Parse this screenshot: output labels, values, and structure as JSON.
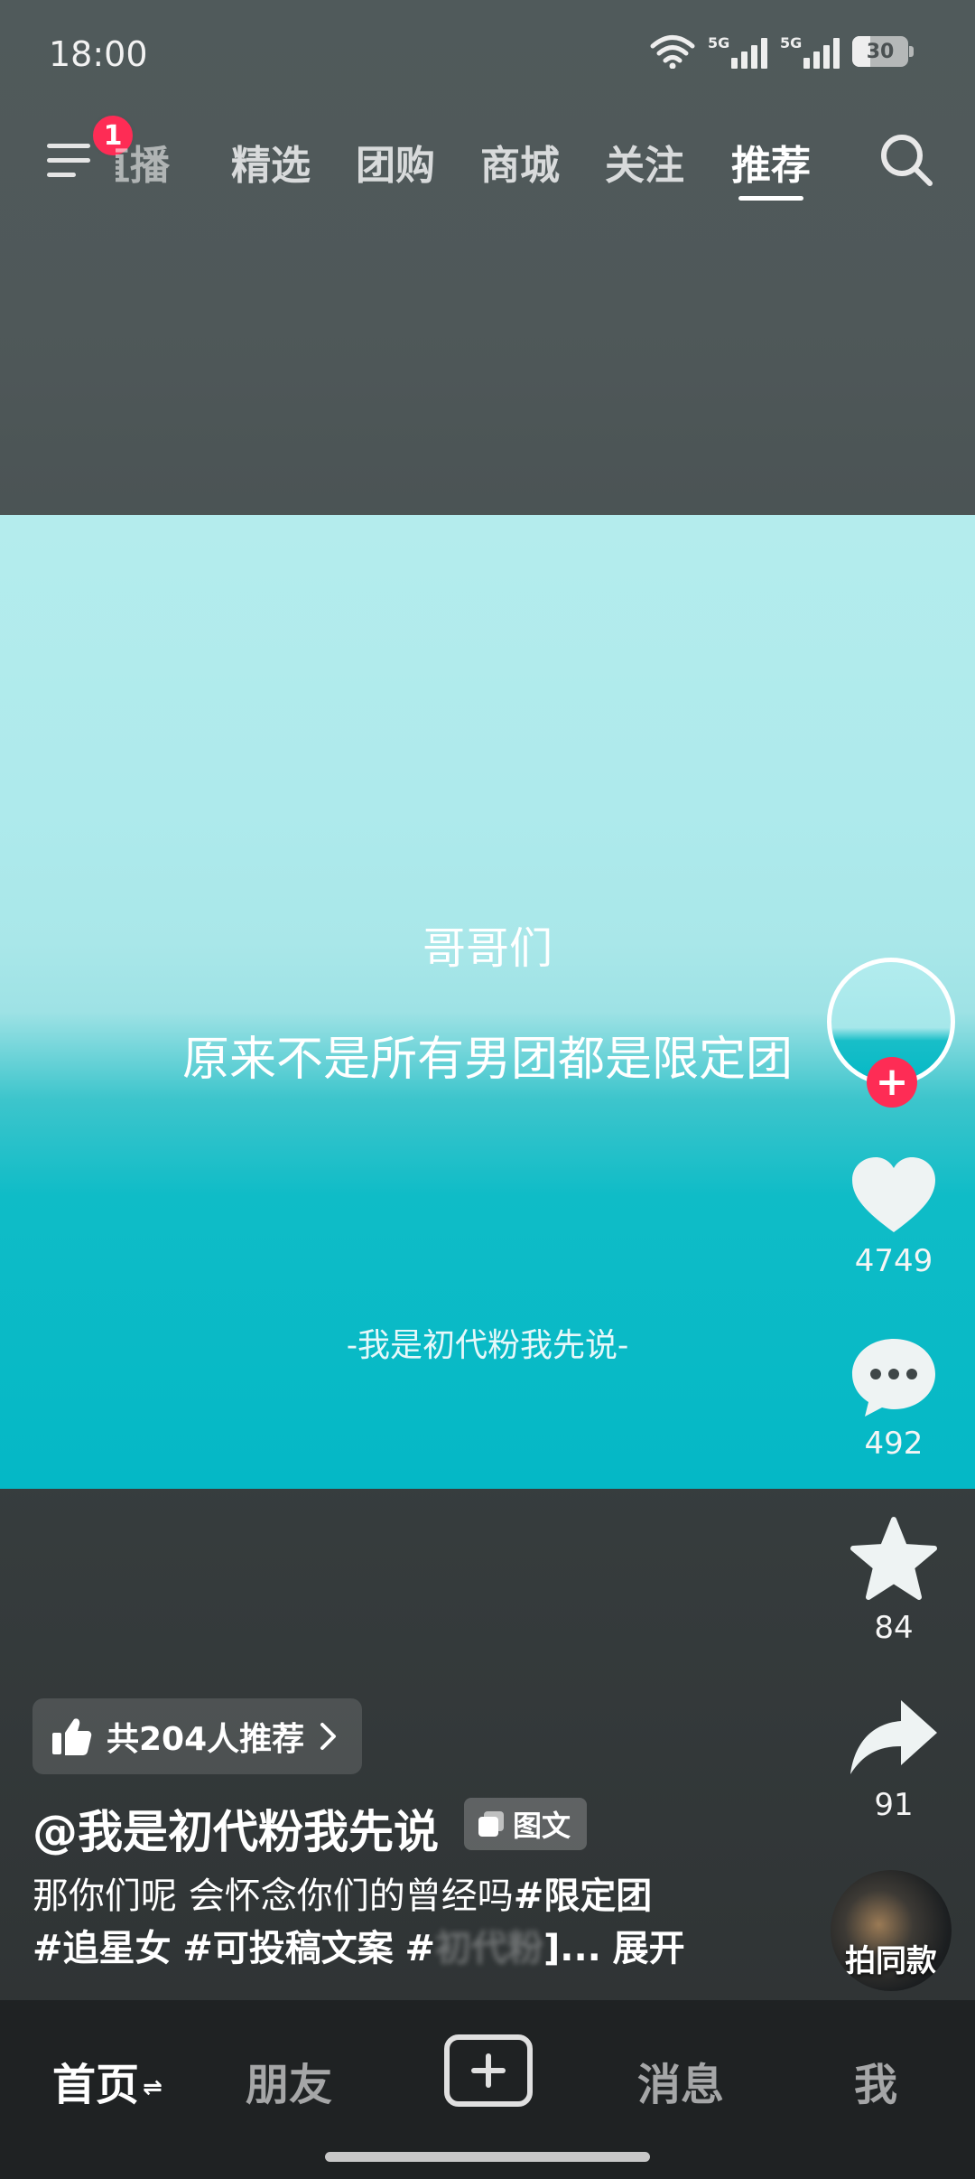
{
  "status_bar": {
    "time": "18:00",
    "network_1": "5G",
    "network_2": "5G",
    "battery": "30",
    "icons": [
      "wifi-icon",
      "signal-icon",
      "signal-icon",
      "battery-icon"
    ]
  },
  "top_nav": {
    "notification_count": "1",
    "tabs": [
      {
        "label": "直播",
        "state": "partially-hidden"
      },
      {
        "label": "精选"
      },
      {
        "label": "团购"
      },
      {
        "label": "商城"
      },
      {
        "label": "关注"
      },
      {
        "label": "推荐",
        "state": "active"
      }
    ],
    "icons": [
      "menu-icon",
      "search-icon"
    ]
  },
  "post": {
    "line1": "哥哥们",
    "line2": "原来不是所有男团都是限定团",
    "signature": "-我是初代粉我先说-",
    "colors": {
      "top": "#b4eced",
      "bottom": "#04b8c6"
    }
  },
  "actions": {
    "like_count": "4749",
    "comment_count": "492",
    "favorite_count": "84",
    "share_count": "91",
    "follow_symbol": "+",
    "remix_label": "拍同款",
    "like_color": "#eef3f3",
    "follow_color": "#fe2c55"
  },
  "info": {
    "recommend_text": "共204人推荐",
    "author": "@我是初代粉我先说",
    "type_chip": "图文",
    "caption_text": "那你们呢 会怀念你们的曾经吗",
    "tag1": "#限定团",
    "tag2": "#追星女",
    "tag3": "#可投稿文案",
    "tag4_prefix": "#",
    "tag4_hidden": "初代粉",
    "tag4_tail": "]...",
    "expand": "展开"
  },
  "tab_bar": {
    "home": "首页",
    "home_refresh": "⇌",
    "friends": "朋友",
    "messages": "消息",
    "me": "我"
  }
}
